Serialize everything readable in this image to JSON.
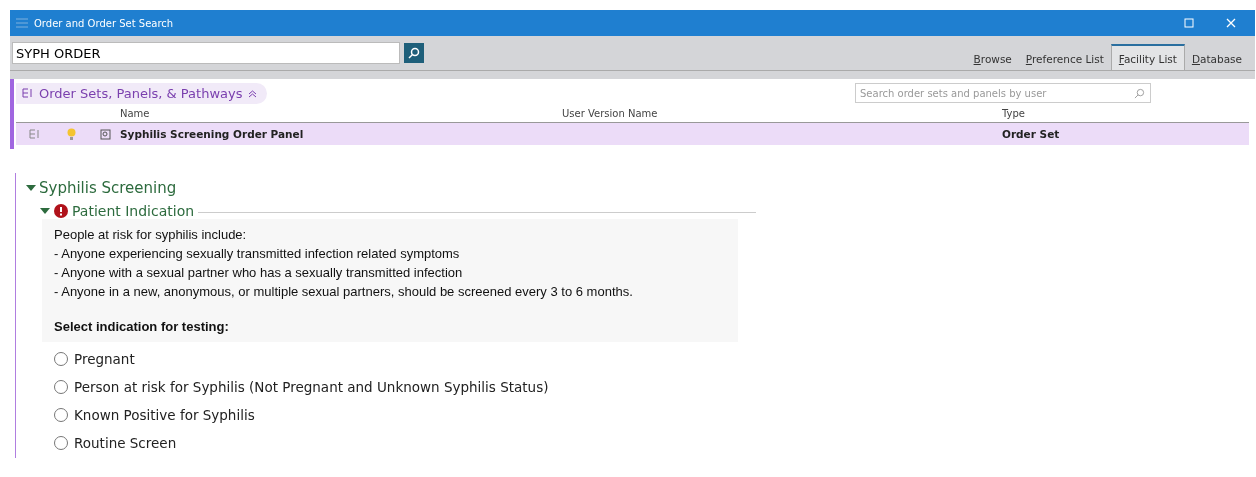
{
  "window": {
    "title": "Order and Order Set Search"
  },
  "search": {
    "value": "SYPH ORDER"
  },
  "tabs": [
    {
      "label": "Browse",
      "selected": false
    },
    {
      "label": "Preference List",
      "selected": false
    },
    {
      "label": "Facility List",
      "selected": true
    },
    {
      "label": "Database",
      "selected": false
    }
  ],
  "section": {
    "title": "Order Sets, Panels, & Pathways",
    "expanded": true,
    "user_search": {
      "placeholder": "Search order sets and panels by user"
    }
  },
  "table": {
    "columns": [
      "Name",
      "User Version Name",
      "Type"
    ],
    "rows": [
      {
        "name": "Syphilis Screening Order Panel",
        "user_version_name": "",
        "type": "Order Set",
        "selected": true
      }
    ]
  },
  "order_set": {
    "title": "Syphilis Screening",
    "expanded": true,
    "group": {
      "title": "Patient Indication",
      "expanded": true,
      "required": true,
      "info_lines": [
        "People at risk for syphilis include:",
        "- Anyone experiencing sexually transmitted infection related symptoms",
        "- Anyone with a sexual partner who has a sexually transmitted infection",
        "- Anyone in a new, anonymous, or multiple sexual partners, should be screened every 3 to 6 months."
      ],
      "prompt": "Select indication for testing:",
      "options": [
        {
          "label": "Pregnant",
          "selected": false
        },
        {
          "label": "Person at risk for Syphilis (Not Pregnant and Unknown Syphilis Status)",
          "selected": false
        },
        {
          "label": "Known Positive for Syphilis",
          "selected": false
        },
        {
          "label": "Routine Screen",
          "selected": false
        }
      ]
    }
  }
}
